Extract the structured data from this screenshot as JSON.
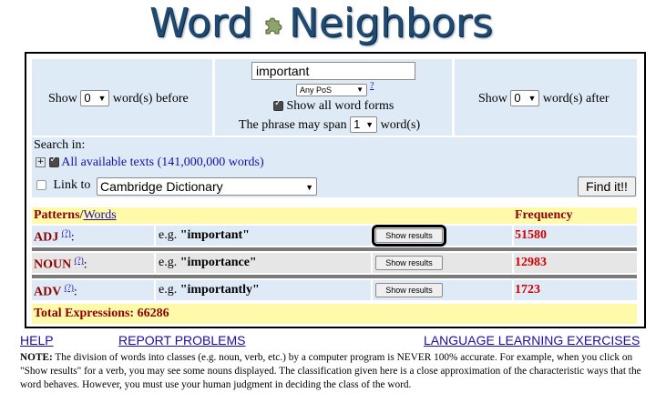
{
  "logo": {
    "word_left": "Word",
    "word_right": "Neighbors"
  },
  "controls": {
    "show_before_label": "Show",
    "before_value": "0",
    "before_suffix": "word(s) before",
    "search_value": "important",
    "pos_value": "Any PoS",
    "pos_help": "?",
    "show_all_forms": "Show all word forms",
    "span_prefix": "The phrase may span",
    "span_value": "1",
    "span_suffix": "word(s)",
    "show_after_label": "Show",
    "after_value": "0",
    "after_suffix": "word(s) after"
  },
  "search_in": {
    "label": "Search in:",
    "expand": "+",
    "texts_label": "All available texts (141,000,000 words)"
  },
  "link_to": {
    "label": "Link to",
    "dictionary": "Cambridge Dictionary",
    "find_button": "Find it!!"
  },
  "table": {
    "header_patterns": "Patterns",
    "header_slash": "/",
    "header_words": "Words",
    "header_frequency": "Frequency",
    "rows": [
      {
        "pos": "ADJ",
        "help": "(?)",
        "colon": ":",
        "example_prefix": "e.g.",
        "example": "\"important\"",
        "button": "Show results",
        "frequency": "51580"
      },
      {
        "pos": "NOUN",
        "help": "(?)",
        "colon": ":",
        "example_prefix": "e.g.",
        "example": "\"importance\"",
        "button": "Show results",
        "frequency": "12983"
      },
      {
        "pos": "ADV",
        "help": "(?)",
        "colon": ":",
        "example_prefix": "e.g.",
        "example": "\"importantly\"",
        "button": "Show results",
        "frequency": "1723"
      }
    ],
    "total": "Total Expressions: 66286"
  },
  "links": {
    "help": "HELP",
    "report": "REPORT PROBLEMS",
    "exercises": "LANGUAGE LEARNING EXERCISES"
  },
  "note": {
    "label": "NOTE:",
    "text": "The division of words into classes (e.g. noun, verb, etc.) by a computer program is NEVER 100% accurate. For example, when you click on \"Show results\" for a verb, you may see some nouns displayed. The classification given here is a close approximation of the characteristic ways that the word behaves. However, you must use your human judgment in deciding the class of the word."
  },
  "colors": {
    "panel_blue": "#dfeaf7",
    "header_yellow": "#fffaa9",
    "row_gray": "#e6e6e6",
    "frequency_red": "#d00000",
    "logo_blue": "#1f4a73"
  }
}
